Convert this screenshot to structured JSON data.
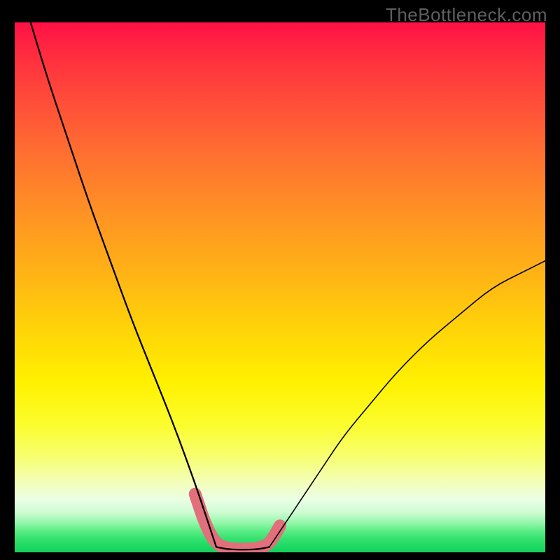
{
  "watermark": "TheBottleneck.com",
  "chart_data": {
    "type": "line",
    "title": "",
    "xlabel": "",
    "ylabel": "",
    "xlim": [
      0,
      100
    ],
    "ylim": [
      0,
      100
    ],
    "grid": false,
    "notes": "V-shaped bottleneck curve over rainbow gradient; reaches minimum (flat bottom) around x 38–48 at y≈1. Left branch from (3,100) down; right branch rises to (100,55). No axis ticks or labels rendered.",
    "series": [
      {
        "name": "curve-left",
        "x": [
          3,
          6,
          10,
          14,
          18,
          22,
          26,
          30,
          34,
          37,
          38
        ],
        "y": [
          100,
          90,
          78,
          66,
          55,
          44,
          34,
          24,
          13,
          4,
          1
        ]
      },
      {
        "name": "flat-bottom",
        "x": [
          38,
          40,
          42,
          44,
          46,
          48
        ],
        "y": [
          1,
          0.6,
          0.5,
          0.5,
          0.6,
          1
        ]
      },
      {
        "name": "curve-right",
        "x": [
          48,
          50,
          54,
          58,
          62,
          67,
          72,
          78,
          84,
          90,
          96,
          100
        ],
        "y": [
          1,
          4,
          10,
          16,
          22,
          28,
          34,
          40,
          45,
          50,
          53,
          55
        ]
      }
    ],
    "highlight": {
      "name": "pink-marker",
      "color": "#e26f7c",
      "x": [
        34,
        36,
        38,
        40,
        42,
        44,
        46,
        48,
        50
      ],
      "y": [
        11,
        5,
        1.5,
        0.8,
        0.6,
        0.6,
        0.8,
        1.5,
        5
      ]
    },
    "gradient_stops": [
      {
        "pos": 0,
        "color": "#ff1045"
      },
      {
        "pos": 0.68,
        "color": "#fff100"
      },
      {
        "pos": 1.0,
        "color": "#12d25c"
      }
    ]
  }
}
